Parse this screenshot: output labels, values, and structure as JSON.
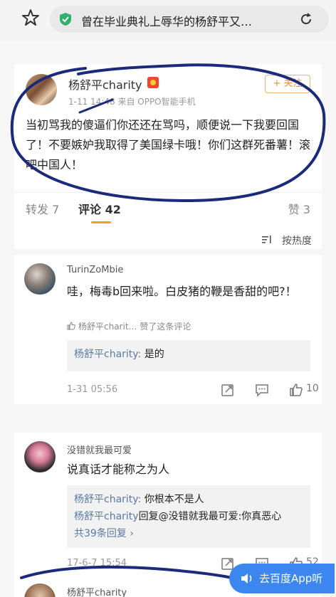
{
  "browser": {
    "title": "曾在毕业典礼上辱华的杨舒平又…",
    "star_icon": "star-icon",
    "shield_icon": "shield-check-icon",
    "reload_icon": "reload-icon"
  },
  "post": {
    "username": "杨舒平charity",
    "meta": "1-11 14:48  来自 OPPO智能手机",
    "follow_label": "+ 关注",
    "text": "当初骂我的傻逼们你还还在骂吗，顺便说一下我要回国了！不要嫉妒我取得了美国绿卡哦！你们这群死番薯！滚吧中国人！"
  },
  "tabs": {
    "repost": "转发 7",
    "comments": "评论 42",
    "likes": "赞 3"
  },
  "sort": {
    "label": "按热度"
  },
  "comments": [
    {
      "username": "TurinZoMbie",
      "text": "哇，梅毒b回来啦。白皮猪的鞭是香甜的吧?！",
      "liked_by": "杨舒平charit… 赞了这条评论",
      "replies": [
        {
          "user": "杨舒平charity:",
          "text": " 是的"
        }
      ],
      "date": "1-31 05:56",
      "likes": "10"
    },
    {
      "username": "没错就我最可爱",
      "text": "说真话才能称之为人",
      "replies": [
        {
          "user": "杨舒平charity:",
          "text": " 你根本不是人"
        },
        {
          "user": "杨舒平charity",
          "text": "回复@没错就我最可爱:你真恶心"
        }
      ],
      "more_replies": "共39条回复 ›",
      "date": "17-6-7 15:54",
      "likes": "52"
    },
    {
      "username": "杨舒平charity"
    }
  ],
  "app_button": {
    "label": "去百度App听"
  },
  "colors": {
    "accent_blue": "#3b86ef",
    "link_blue": "#5b7aa8",
    "ink_circle": "#1b2a7a",
    "follow_orange": "#e8b56e"
  }
}
